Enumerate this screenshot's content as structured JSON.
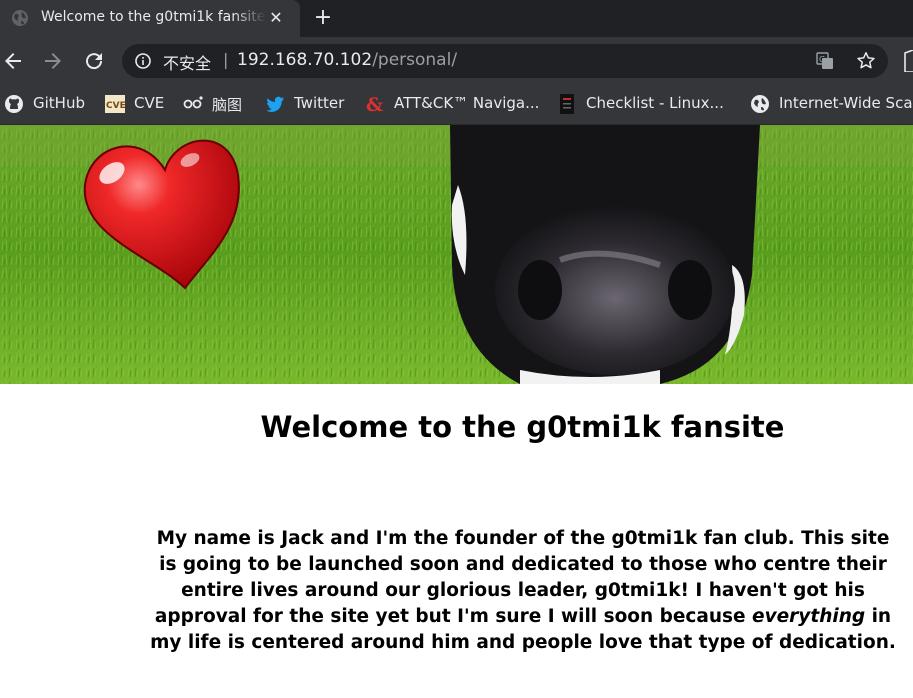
{
  "browser": {
    "tab": {
      "title": "Welcome to the g0tmi1k fansite",
      "close_glyph": "✕",
      "favicon": "globe-icon"
    },
    "new_tab_glyph": "+",
    "omnibox": {
      "security_label": "不安全",
      "separator": "|",
      "url_host": "192.168.70.102",
      "url_path": "/personal/"
    },
    "bookmarks": [
      {
        "label": "GitHub",
        "icon": "github-icon"
      },
      {
        "label": "CVE",
        "icon": "cve-icon"
      },
      {
        "label": "脑图",
        "icon": "mindmap-icon"
      },
      {
        "label": "Twitter",
        "icon": "twitter-icon"
      },
      {
        "label": "ATT&CK™ Naviga...",
        "icon": "attack-icon"
      },
      {
        "label": "Checklist - Linux...",
        "icon": "checklist-icon"
      },
      {
        "label": "Internet-Wide Sca...",
        "icon": "globe-icon"
      }
    ]
  },
  "page": {
    "hero": {
      "image": "cow-nose-on-grass-with-heart"
    },
    "title": "Welcome to the g0tmi1k fansite",
    "intro_before": "My name is Jack and I'm the founder of the g0tmi1k fan club. This site is going to be launched soon and dedicated to those who centre their entire lives around our glorious leader, g0tmi1k! I haven't got his approval for the site yet but I'm sure I will soon because ",
    "intro_emphasis": "everything",
    "intro_after": " in my life is centered around him and people love that type of dedication."
  },
  "colors": {
    "tab_bg": "#35363a",
    "strip_bg": "#202124",
    "text_light": "#e8eaed",
    "text_dim": "#9aa0a6",
    "heart": "#e0141a",
    "grass": "#5aa020"
  }
}
